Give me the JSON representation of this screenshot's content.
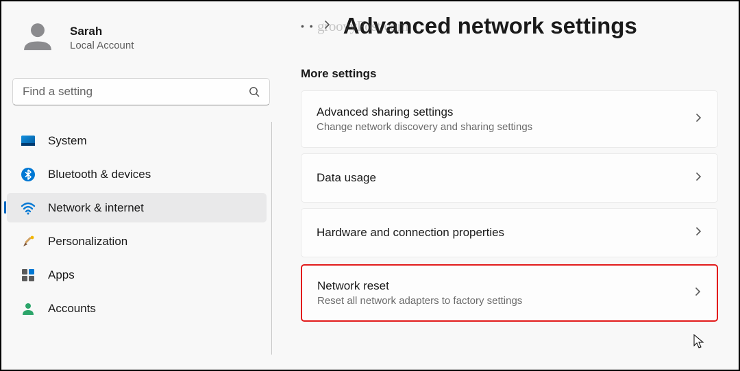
{
  "user": {
    "name": "Sarah",
    "sub": "Local Account"
  },
  "search": {
    "placeholder": "Find a setting"
  },
  "nav": {
    "items": [
      {
        "label": "System"
      },
      {
        "label": "Bluetooth & devices"
      },
      {
        "label": "Network & internet"
      },
      {
        "label": "Personalization"
      },
      {
        "label": "Apps"
      },
      {
        "label": "Accounts"
      }
    ]
  },
  "page": {
    "title": "Advanced network settings"
  },
  "section": {
    "heading": "More settings"
  },
  "cards": [
    {
      "title": "Advanced sharing settings",
      "sub": "Change network discovery and sharing settings"
    },
    {
      "title": "Data usage",
      "sub": ""
    },
    {
      "title": "Hardware and connection properties",
      "sub": ""
    },
    {
      "title": "Network reset",
      "sub": "Reset all network adapters to factory settings"
    }
  ],
  "watermark": "groovyPost.com"
}
